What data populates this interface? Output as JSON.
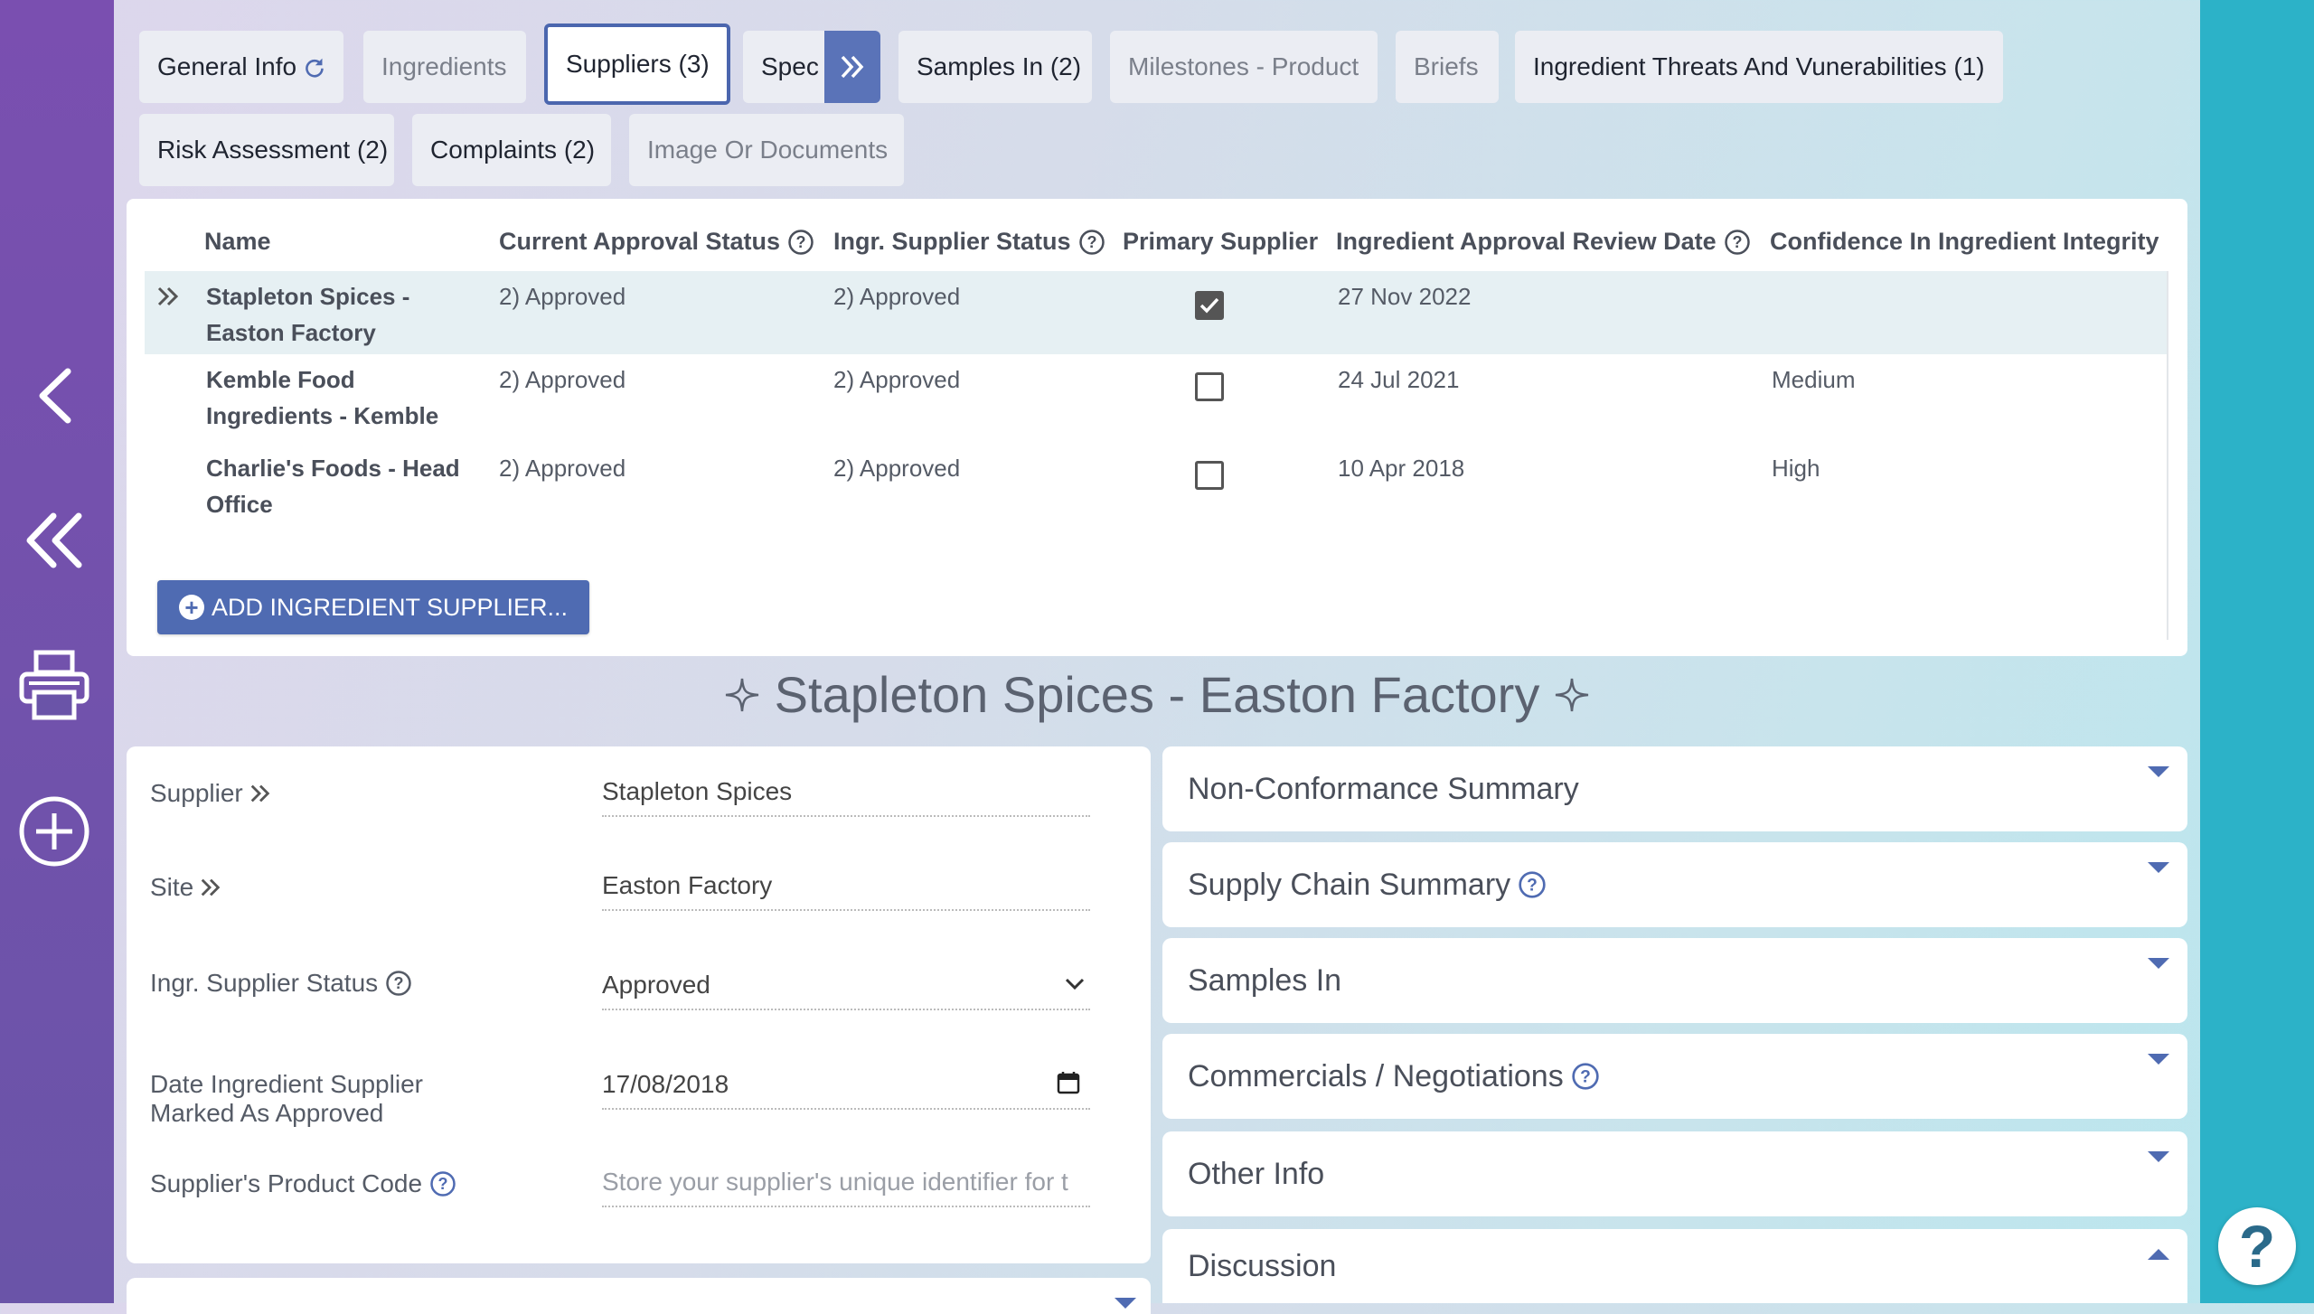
{
  "tabs": [
    {
      "label": "General Info"
    },
    {
      "label": "Ingredients"
    },
    {
      "label": "Suppliers (3)"
    },
    {
      "label": "Spec"
    },
    {
      "label": "Samples In (2)"
    },
    {
      "label": "Milestones - Product"
    },
    {
      "label": "Briefs"
    },
    {
      "label": "Ingredient Threats And Vunerabilities (1)"
    },
    {
      "label": "Risk Assessment (2)"
    },
    {
      "label": "Complaints (2)"
    },
    {
      "label": "Image Or Documents"
    }
  ],
  "table": {
    "headers": {
      "name": "Name",
      "approval_status": "Current Approval Status",
      "supplier_status": "Ingr. Supplier Status",
      "primary": "Primary Supplier",
      "review_date": "Ingredient Approval Review Date",
      "confidence": "Confidence In Ingredient Integrity"
    },
    "rows": [
      {
        "name_line1": "Stapleton Spices -",
        "name_line2": "Easton Factory",
        "approval_status": "2) Approved",
        "supplier_status": "2) Approved",
        "primary": true,
        "review_date": "27 Nov 2022",
        "confidence": ""
      },
      {
        "name_line1": "Kemble Food",
        "name_line2": "Ingredients - Kemble",
        "approval_status": "2) Approved",
        "supplier_status": "2) Approved",
        "primary": false,
        "review_date": "24 Jul 2021",
        "confidence": "Medium"
      },
      {
        "name_line1": "Charlie's Foods - Head",
        "name_line2": "Office",
        "approval_status": "2) Approved",
        "supplier_status": "2) Approved",
        "primary": false,
        "review_date": "10 Apr 2018",
        "confidence": "High"
      }
    ],
    "add_button": "ADD INGREDIENT SUPPLIER..."
  },
  "detail": {
    "title": "Stapleton Spices - Easton Factory",
    "fields": {
      "supplier_label": "Supplier",
      "supplier_value": "Stapleton Spices",
      "site_label": "Site",
      "site_value": "Easton Factory",
      "status_label": "Ingr. Supplier Status",
      "status_value": "Approved",
      "date_label_1": "Date Ingredient Supplier",
      "date_label_2": "Marked As Approved",
      "date_value": "17/08/2018",
      "code_label": "Supplier's Product Code",
      "code_placeholder": "Store your supplier's unique identifier for t"
    }
  },
  "accordions": [
    {
      "label": "Non-Conformance Summary"
    },
    {
      "label": "Supply Chain Summary"
    },
    {
      "label": "Samples In"
    },
    {
      "label": "Commercials / Negotiations"
    },
    {
      "label": "Other Info"
    },
    {
      "label": "Discussion"
    }
  ],
  "colors": {
    "sidebar": "#7a4fb0",
    "right_rail": "#2cb2c8",
    "accent": "#4f6bb2",
    "help_icon": "#4f6bb2"
  }
}
